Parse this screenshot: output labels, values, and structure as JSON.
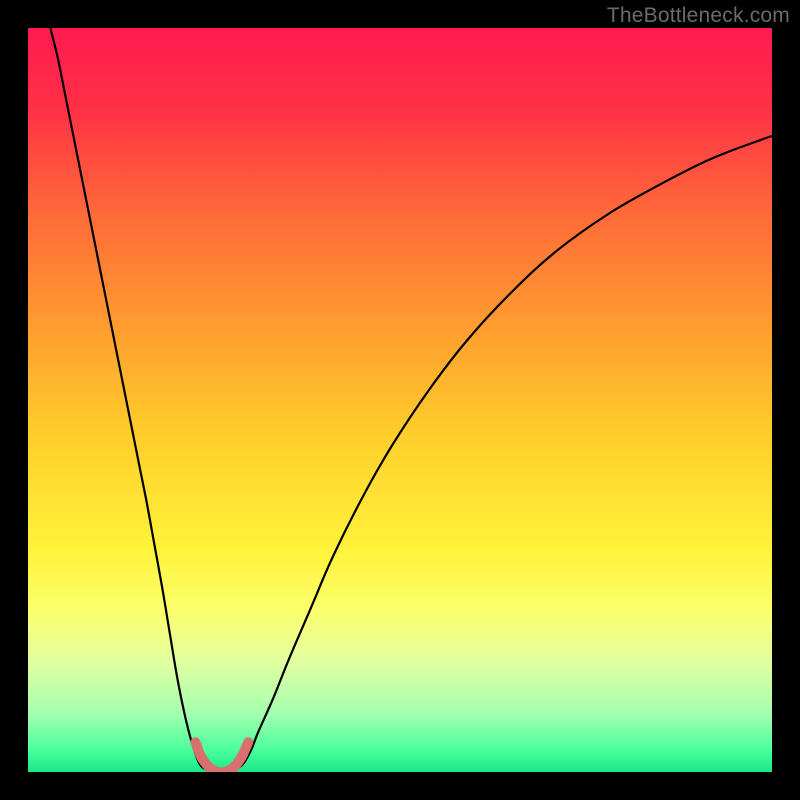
{
  "watermark": "TheBottleneck.com",
  "chart_data": {
    "type": "line",
    "title": "",
    "xlabel": "",
    "ylabel": "",
    "xlim": [
      0,
      100
    ],
    "ylim": [
      0,
      100
    ],
    "background": {
      "type": "vertical-gradient",
      "stops": [
        {
          "pos": 0.0,
          "color": "#ff1a50"
        },
        {
          "pos": 0.1,
          "color": "#ff2e47"
        },
        {
          "pos": 0.25,
          "color": "#ff6a39"
        },
        {
          "pos": 0.4,
          "color": "#ff9c2f"
        },
        {
          "pos": 0.55,
          "color": "#ffcf2b"
        },
        {
          "pos": 0.7,
          "color": "#fff23a"
        },
        {
          "pos": 0.78,
          "color": "#fcff6a"
        },
        {
          "pos": 0.85,
          "color": "#e3ffa0"
        },
        {
          "pos": 0.92,
          "color": "#a6ffb0"
        },
        {
          "pos": 0.97,
          "color": "#4cff9e"
        },
        {
          "pos": 1.0,
          "color": "#19e887"
        }
      ]
    },
    "series": [
      {
        "name": "left-curve",
        "color": "#000000",
        "width": 2.2,
        "x": [
          3,
          4,
          5,
          6,
          7,
          8,
          9,
          10,
          11,
          12,
          13,
          14,
          15,
          16,
          17,
          18,
          19,
          20,
          21,
          22,
          23,
          24,
          25,
          26
        ],
        "y": [
          100,
          96,
          91,
          86,
          81,
          76,
          71,
          66,
          61,
          56,
          51,
          46,
          41,
          36,
          30.5,
          25,
          19,
          13,
          8,
          4,
          1.2,
          0.3,
          0,
          0
        ]
      },
      {
        "name": "right-curve",
        "color": "#000000",
        "width": 2.2,
        "x": [
          26,
          27,
          28,
          29,
          30,
          31,
          33,
          35,
          38,
          41,
          45,
          49,
          54,
          59,
          65,
          71,
          78,
          85,
          92,
          100
        ],
        "y": [
          0,
          0,
          0.4,
          1.2,
          3,
          5.5,
          10,
          15,
          22,
          29,
          37,
          44,
          51.5,
          58,
          64.5,
          70,
          75,
          79,
          82.5,
          85.5
        ]
      },
      {
        "name": "valley-highlight",
        "color": "#d97070",
        "width": 10,
        "linecap": "round",
        "x": [
          22.5,
          23.2,
          24.0,
          24.8,
          25.6,
          26.4,
          27.2,
          28.0,
          28.8,
          29.6
        ],
        "y": [
          4.0,
          2.2,
          1.0,
          0.3,
          0.0,
          0.0,
          0.3,
          1.0,
          2.2,
          4.0
        ]
      }
    ]
  }
}
